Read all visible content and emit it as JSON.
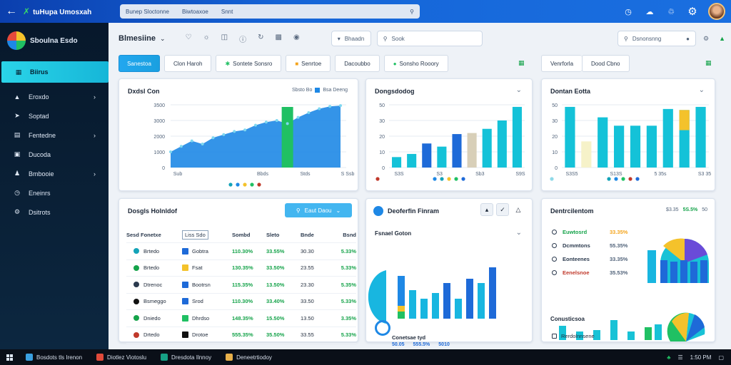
{
  "topbar": {
    "brand": "tuHupa Umosxah",
    "url_parts": [
      "Bunep Sloctonne",
      "Biwtoaxoe",
      "Snnt"
    ]
  },
  "sidebar": {
    "app_name": "Sboulna Esdo",
    "items": [
      {
        "label": "Biirus",
        "icon": "grid-icon",
        "active": true,
        "arrow": false
      },
      {
        "label": "Eroxdo",
        "icon": "dashboard-icon",
        "active": false,
        "arrow": true
      },
      {
        "label": "Soptad",
        "icon": "send-icon",
        "active": false,
        "arrow": false
      },
      {
        "label": "Fentedne",
        "icon": "chart-icon",
        "active": false,
        "arrow": true
      },
      {
        "label": "Ducoda",
        "icon": "folder-icon",
        "active": false,
        "arrow": false
      },
      {
        "label": "Bmbooie",
        "icon": "users-icon",
        "active": false,
        "arrow": true
      },
      {
        "label": "Eneinrs",
        "icon": "clock-icon",
        "active": false,
        "arrow": false
      },
      {
        "label": "Dsitrots",
        "icon": "settings-icon",
        "active": false,
        "arrow": false
      }
    ]
  },
  "header": {
    "title": "Blmesiine",
    "filter_btn": "Bhaadn",
    "search_placeholder": "Sook",
    "search2_placeholder": "Dsnonsnng"
  },
  "tabs": [
    {
      "label": "Sanestoa",
      "active": true,
      "dot": ""
    },
    {
      "label": "Clon Haroh",
      "active": false,
      "dot": ""
    },
    {
      "label": "Sontete Sonsro",
      "active": false,
      "dot": "#20c063"
    },
    {
      "label": "Senrtoe",
      "active": false,
      "dot": "#f4a41c"
    },
    {
      "label": "Dacoubbo",
      "active": false,
      "dot": ""
    },
    {
      "label": "Sonsho Rooory",
      "active": false,
      "dot": "#20c063"
    }
  ],
  "tabs_right": [
    "Venrforla",
    "Dood Cbno"
  ],
  "cards": {
    "area": {
      "title": "Dxdsl Con",
      "legend": "Sbsto Bo",
      "legend2": "Bsa Deeng"
    },
    "bars1": {
      "title": "Dongsdodog"
    },
    "bars2": {
      "title": "Dontan Eotta"
    },
    "table": {
      "title": "Dosgls Holnldof",
      "action": "Eaut Daou"
    },
    "bars3": {
      "title": "Deoferfin Finram",
      "subtitle": "Fsnael Goton",
      "footer_title": "Conetsae tyd",
      "footer_vals": [
        "50.05",
        "555.5%",
        "5010"
      ]
    },
    "donut": {
      "title": "Dentrcilentom",
      "head_vals": [
        "$3.35",
        "5S.5%",
        "50"
      ],
      "items": [
        {
          "label": "Euwtosrd",
          "value": "33.35%",
          "color": "#15a34a"
        },
        {
          "label": "Dcmmtons",
          "value": "55.35%",
          "color": "#2b3a4e"
        },
        {
          "label": "Eonteenes",
          "value": "33.35%",
          "color": "#2b3a4e"
        },
        {
          "label": "Eenelsnoe",
          "value": "35.53%",
          "color": "#c0392b"
        }
      ],
      "sub_title": "Conusticsoa",
      "sub_item": "Rerdolnnsene"
    }
  },
  "table": {
    "headers": [
      "Sesd Fonetxe",
      "Liss Sdo",
      "Sombd",
      "Sleto",
      "Bnde",
      "Bsnd"
    ],
    "rows": [
      {
        "name": "Brtedo",
        "dot": "#14a3b8",
        "sq": "#1e6ad8",
        "cat": "Gobtra",
        "v1": "110.30%",
        "v2": "33.55%",
        "v3": "30.30",
        "v4": "5.33%"
      },
      {
        "name": "Brtedo",
        "dot": "#15a34a",
        "sq": "#f4c22b",
        "cat": "Fsat",
        "v1": "130.35%",
        "v2": "33.50%",
        "v3": "23.55",
        "v4": "5.33%"
      },
      {
        "name": "Dtrenoc",
        "dot": "#2b3a4e",
        "sq": "#1e6ad8",
        "cat": "Bootrsn",
        "v1": "115.35%",
        "v2": "13.50%",
        "v3": "23.30",
        "v4": "5.35%"
      },
      {
        "name": "Bsmeggo",
        "dot": "#111111",
        "sq": "#1e6ad8",
        "cat": "Srod",
        "v1": "110.30%",
        "v2": "33.40%",
        "v3": "33.50",
        "v4": "5.33%"
      },
      {
        "name": "Dniedo",
        "dot": "#15a34a",
        "sq": "#20c063",
        "cat": "Dhrdso",
        "v1": "148.35%",
        "v2": "15.50%",
        "v3": "13.50",
        "v4": "3.35%"
      },
      {
        "name": "Drtedo",
        "dot": "#c0392b",
        "sq": "#111111",
        "cat": "Drotoe",
        "v1": "555.35%",
        "v2": "35.50%",
        "v3": "33.55",
        "v4": "5.33%"
      }
    ]
  },
  "taskbar": {
    "items": [
      {
        "label": "Bosdots tls Irenon",
        "color": "#3aa0e0"
      },
      {
        "label": "Diotlez Viotoslu",
        "color": "#e04a3a"
      },
      {
        "label": "Dresdota Ilnnoy",
        "color": "#16a085"
      },
      {
        "label": "Deneetrtiodoy",
        "color": "#e8b04a"
      }
    ],
    "time": "1:50 PM"
  },
  "chart_data": [
    {
      "type": "area",
      "title": "Dxdsl Con",
      "categories": [
        "Sub",
        "",
        "Bbds",
        "Stds",
        "S Ssb"
      ],
      "x": [
        0,
        1,
        2,
        3,
        4,
        5,
        6,
        7,
        8,
        9,
        10,
        11,
        12,
        13,
        14,
        15,
        16
      ],
      "values": [
        1000,
        1350,
        1700,
        1500,
        1900,
        2100,
        2300,
        2400,
        2700,
        2900,
        3000,
        2800,
        3200,
        3500,
        3750,
        3900,
        3950
      ],
      "highlight_index": 11,
      "ylim": [
        0,
        4000
      ],
      "yticks": [
        "0",
        "1000",
        "2000",
        "3000",
        "3500"
      ],
      "legend_dots": [
        "#14a3b8",
        "#1e88e5",
        "#f4c22b",
        "#20c063",
        "#c0392b"
      ]
    },
    {
      "type": "bar",
      "title": "Dongsdodog",
      "categories": [
        "S3S",
        "S3",
        "Sb3",
        "S9S"
      ],
      "values": [
        10,
        13,
        23,
        20,
        32,
        33,
        37,
        45,
        58
      ],
      "colors": [
        "#14c2d8",
        "#14c2d8",
        "#1e6ad8",
        "#14c2d8",
        "#1e6ad8",
        "#d8cfb8",
        "#14c2d8",
        "#14c2d8",
        "#14c2d8"
      ],
      "ylim": [
        0,
        60
      ],
      "yticks": [
        "0",
        "10",
        "20",
        "30",
        "50"
      ],
      "legend_dots": [
        "#c0392b",
        "#1e88e5",
        "#14a3b8",
        "#f4c22b",
        "#20c063",
        "#1e6ad8"
      ]
    },
    {
      "type": "bar",
      "title": "Dontan Eotta",
      "categories": [
        "S3S5",
        "S13S",
        "5 35s",
        "S3 35"
      ],
      "values": [
        58,
        25,
        48,
        40,
        40,
        40,
        56,
        55,
        58
      ],
      "colors": [
        "#14c2d8",
        "#f6f2c9",
        "#14c2d8",
        "#14c2d8",
        "#14c2d8",
        "#14c2d8",
        "#14c2d8",
        "#14c2d8",
        "#14c2d8"
      ],
      "top_colors": [
        "",
        "",
        "",
        "",
        "",
        "",
        "",
        "#f4c22b",
        ""
      ],
      "ylim": [
        0,
        60
      ],
      "yticks": [
        "0",
        "10",
        "20",
        "30",
        "50"
      ],
      "legend_dots": [
        "#8fd9e8",
        "#14a3b8",
        "#1e88e5",
        "#20c063",
        "#c0392b",
        "#1e6ad8"
      ]
    }
  ]
}
